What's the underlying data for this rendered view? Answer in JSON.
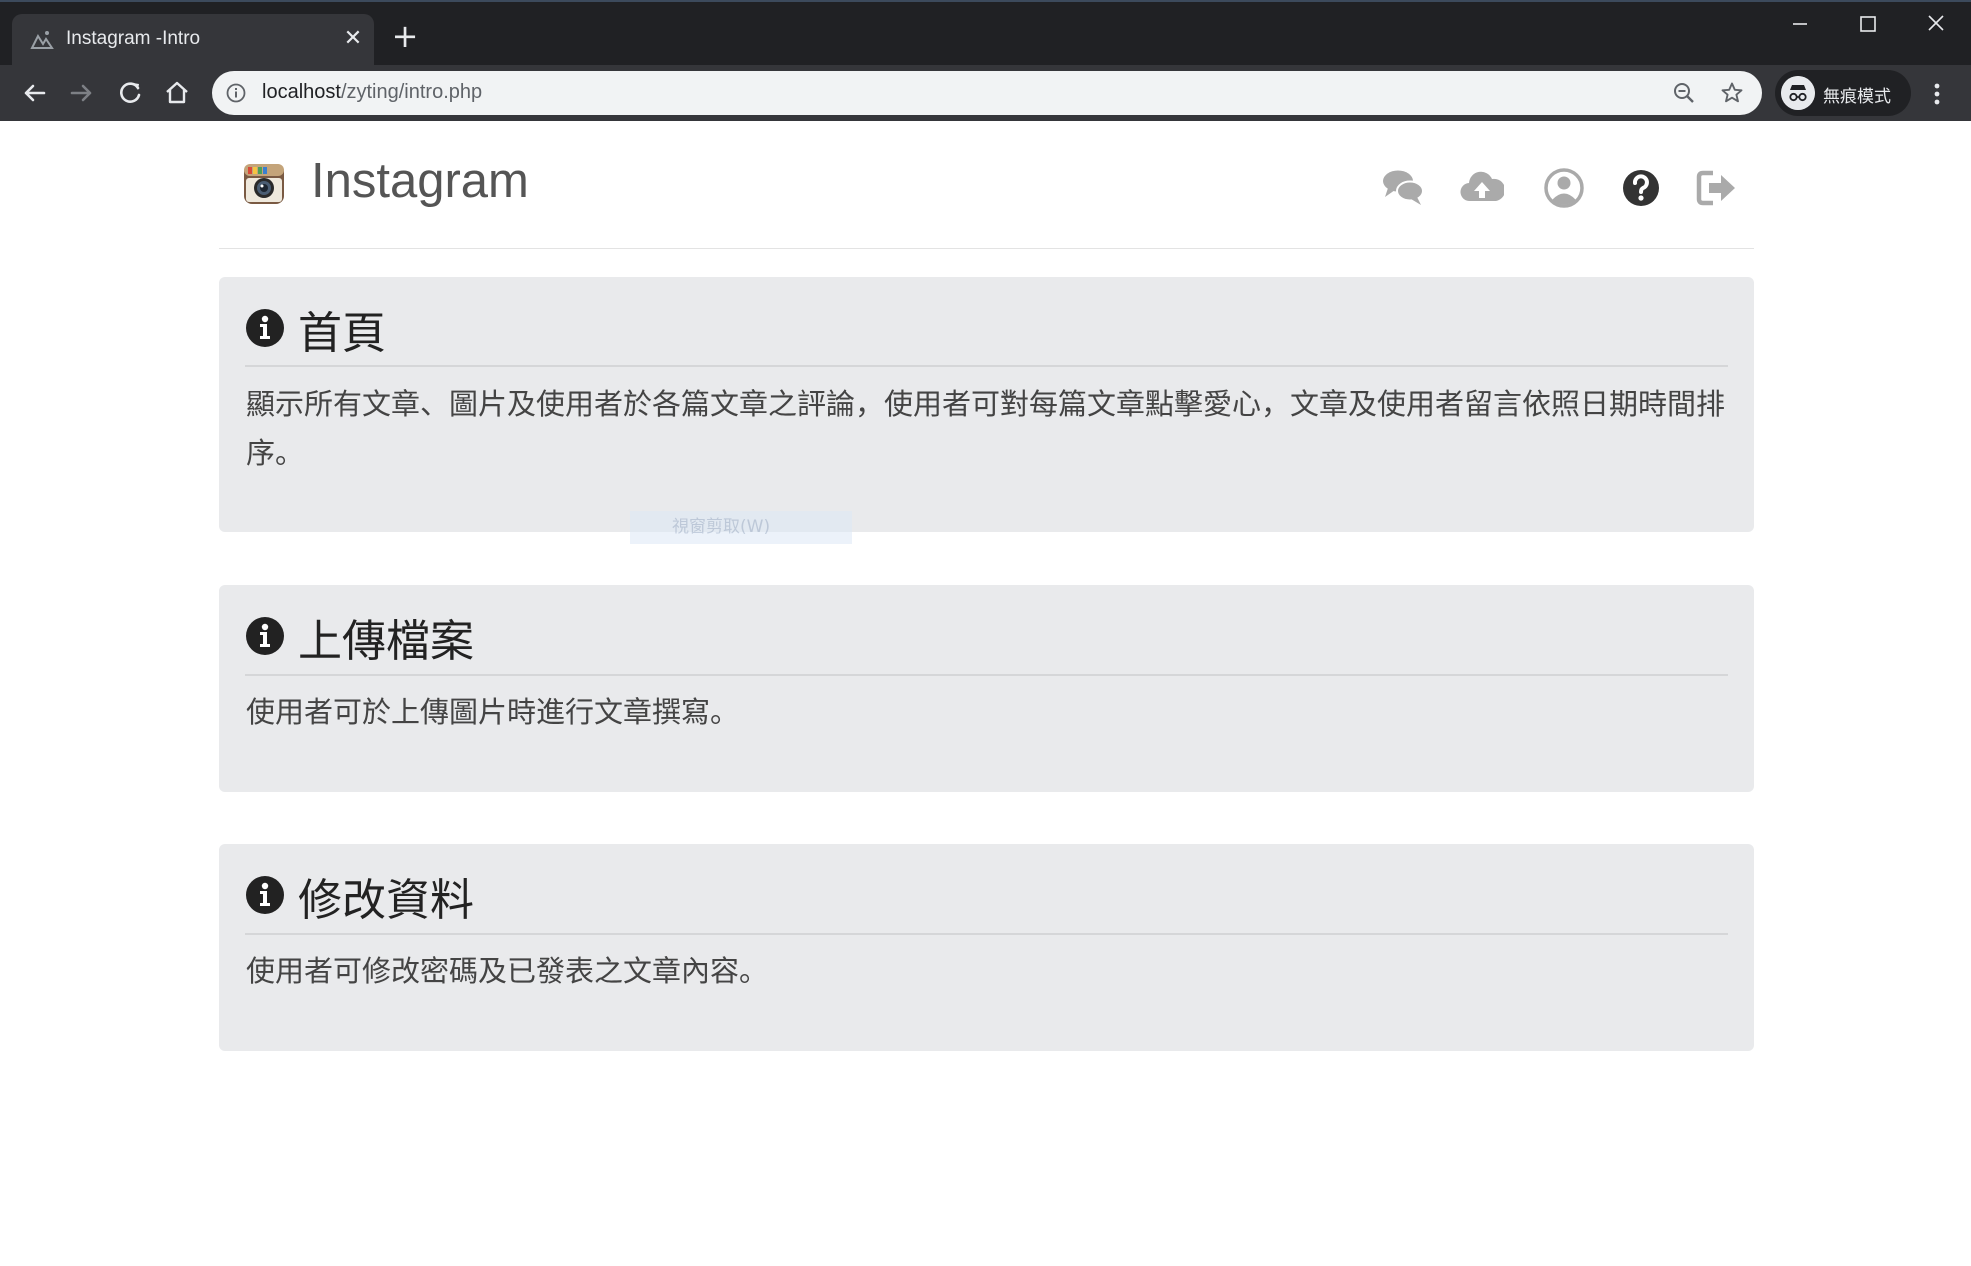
{
  "browser": {
    "tab_title": "Instagram -Intro",
    "tab_close": "✕",
    "new_tab": "+",
    "url_host": "localhost",
    "url_path": "/zyting/intro.php",
    "incognito_label": "無痕模式",
    "icons": {
      "back": "back-arrow-icon",
      "forward": "forward-arrow-icon",
      "reload": "reload-icon",
      "home": "home-icon",
      "site_info": "info-icon",
      "zoom": "zoom-icon",
      "bookmark": "star-icon",
      "menu": "kebab-menu-icon"
    }
  },
  "app": {
    "brand": "Instagram",
    "nav_icons": [
      "chat-icon",
      "cloud-upload-icon",
      "user-icon",
      "help-icon",
      "logout-icon"
    ]
  },
  "sections": [
    {
      "title": "首頁",
      "text": "顯示所有文章、圖片及使用者於各篇文章之評論，使用者可對每篇文章點擊愛心，文章及使用者留言依照日期時間排序。"
    },
    {
      "title": "上傳檔案",
      "text": "使用者可於上傳圖片時進行文章撰寫。"
    },
    {
      "title": "修改資料",
      "text": "使用者可修改密碼及已發表之文章內容。"
    }
  ],
  "overlay": {
    "faded_tooltip": "視窗剪取(W)"
  },
  "colors": {
    "chrome_dark": "#202124",
    "toolbar": "#35363a",
    "omnibox": "#f1f3f4",
    "card_bg": "#e9eaec",
    "nav_icon_gray": "#aaaaaa",
    "nav_icon_dark": "#333333"
  }
}
